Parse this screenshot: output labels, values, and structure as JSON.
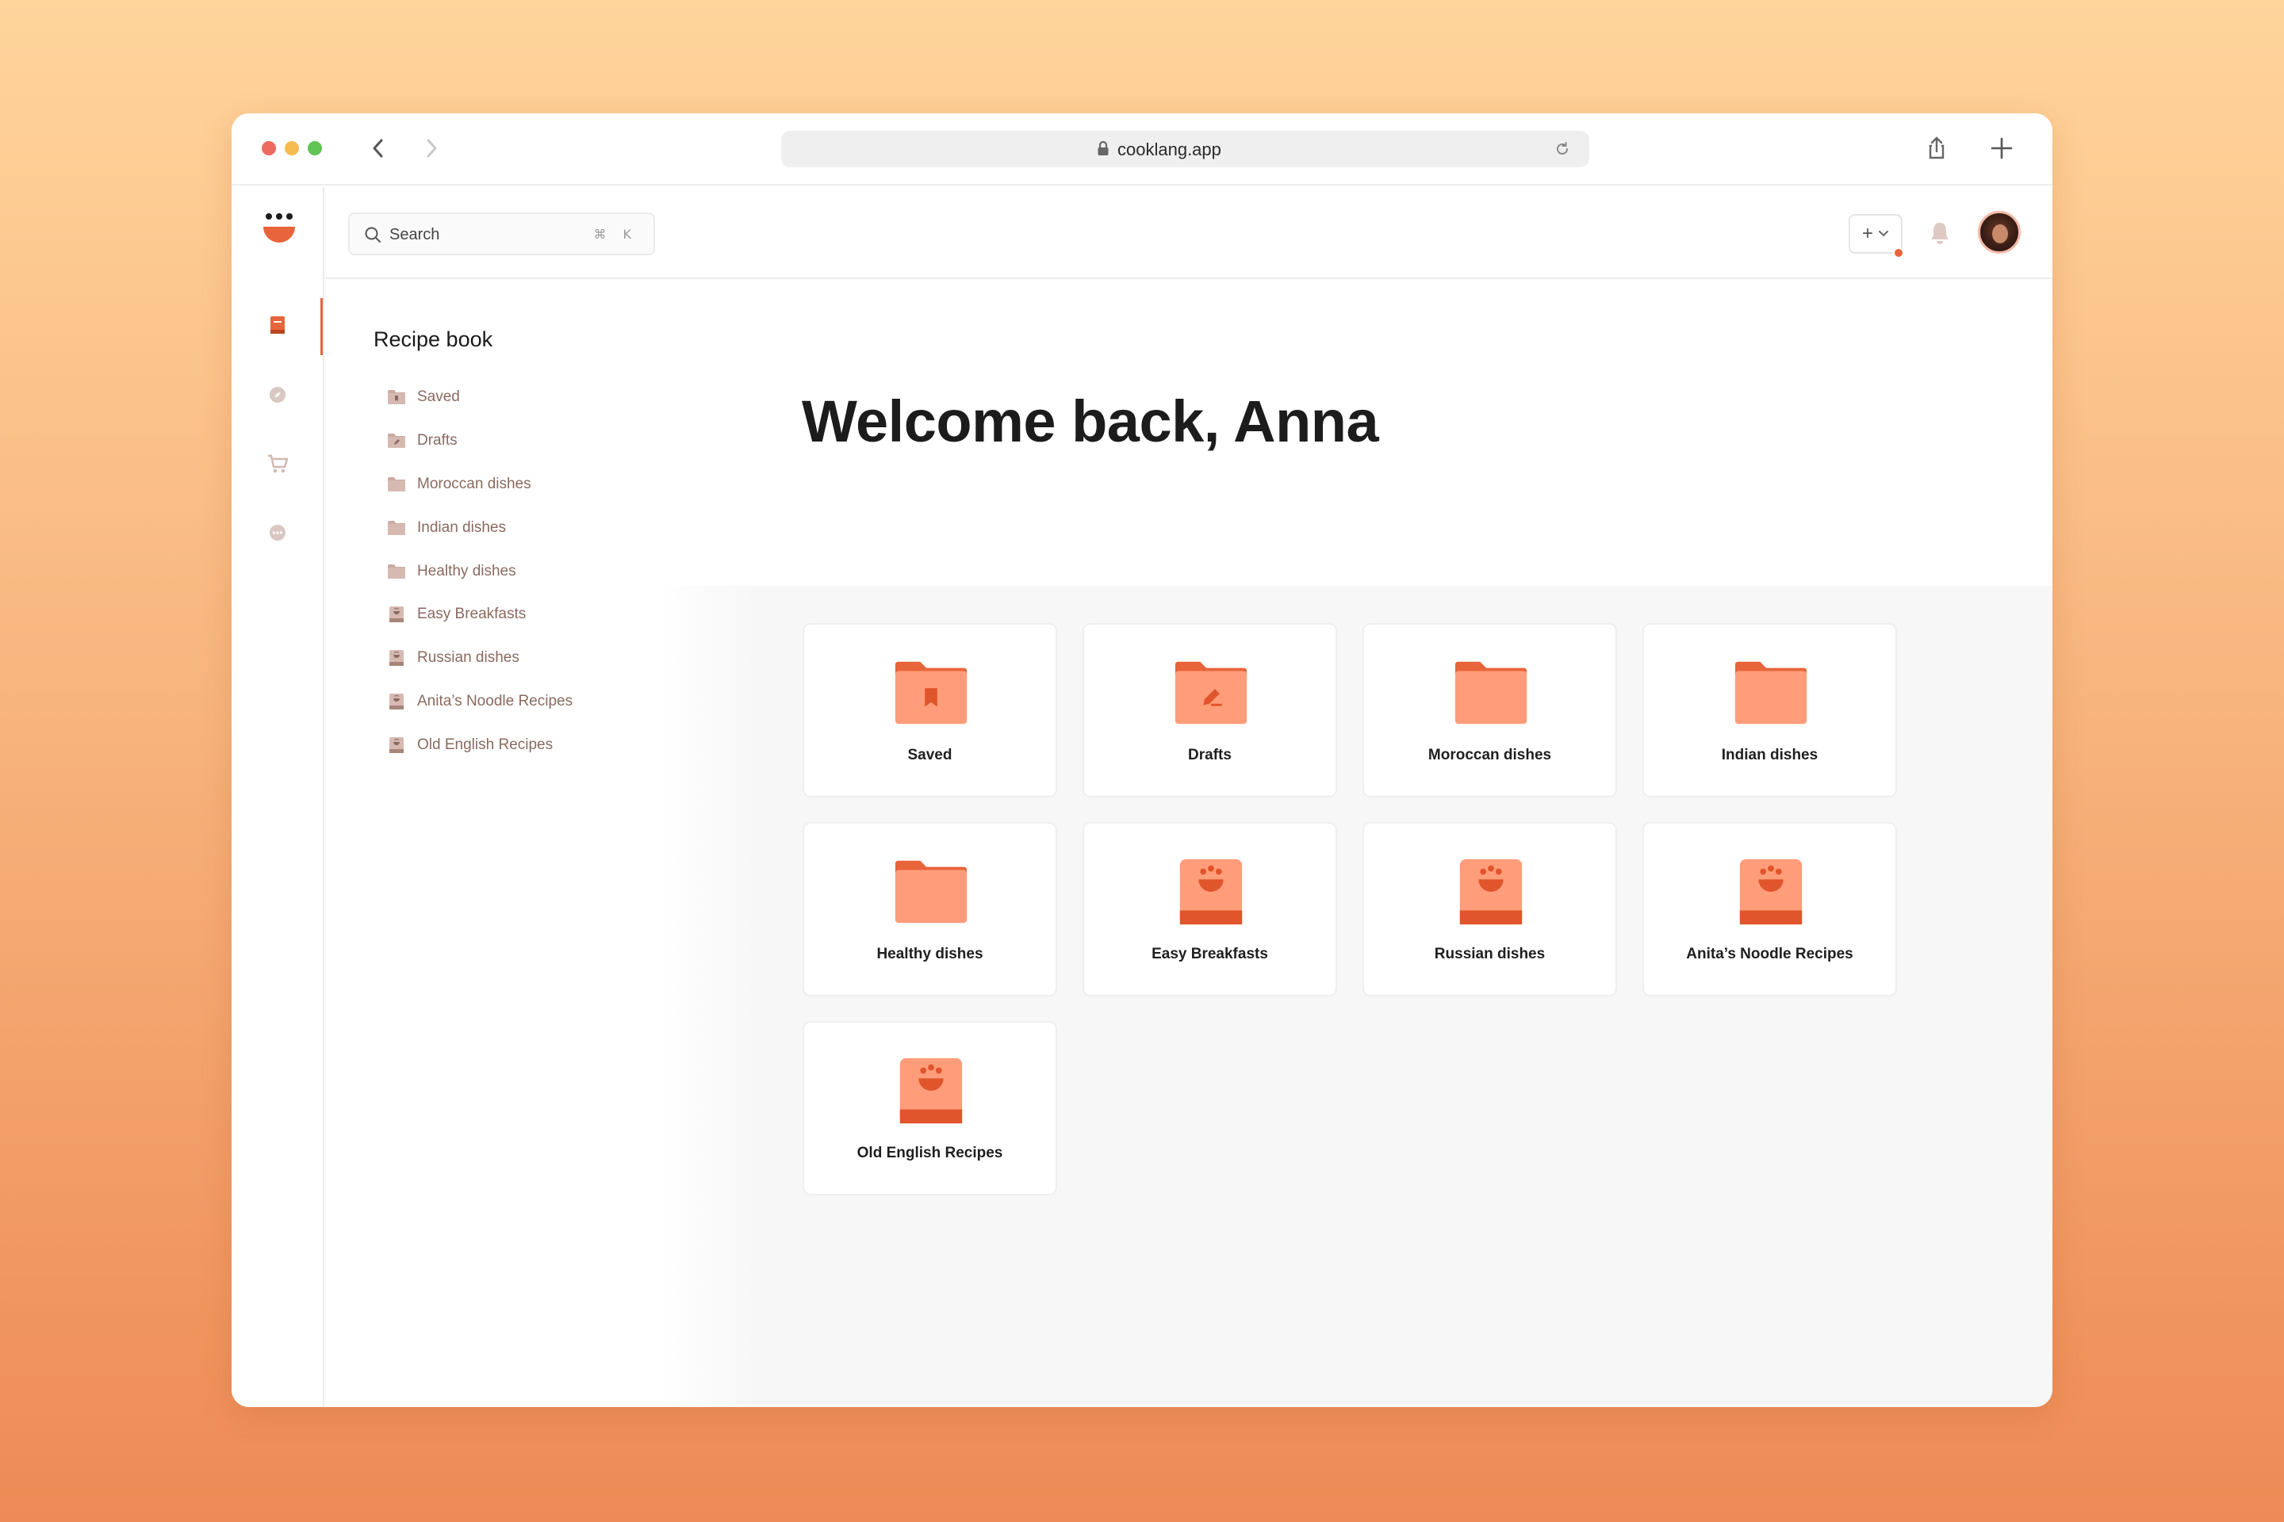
{
  "browser": {
    "url": "cooklang.app",
    "traffic_colors": [
      "#ee6a5f",
      "#f5bd4f",
      "#61c454"
    ]
  },
  "search": {
    "placeholder": "Search",
    "shortcut": "⌘ K"
  },
  "header": {
    "add_label": "+"
  },
  "colors": {
    "accent": "#e8643a",
    "folder": "#ff9d7a",
    "folder_tab": "#e8643a"
  },
  "sidebar": {
    "title": "Recipe book",
    "items": [
      {
        "label": "Saved",
        "icon": "folder-saved-icon"
      },
      {
        "label": "Drafts",
        "icon": "folder-drafts-icon"
      },
      {
        "label": "Moroccan dishes",
        "icon": "folder-icon"
      },
      {
        "label": "Indian dishes",
        "icon": "folder-icon"
      },
      {
        "label": "Healthy dishes",
        "icon": "folder-icon"
      },
      {
        "label": "Easy Breakfasts",
        "icon": "recipe-book-icon"
      },
      {
        "label": "Russian dishes",
        "icon": "recipe-book-icon"
      },
      {
        "label": "Anita’s Noodle Recipes",
        "icon": "recipe-book-icon"
      },
      {
        "label": "Old English Recipes",
        "icon": "recipe-book-icon"
      }
    ]
  },
  "main": {
    "welcome": "Welcome back, Anna",
    "cards": [
      {
        "label": "Saved",
        "icon": "folder-saved-icon"
      },
      {
        "label": "Drafts",
        "icon": "folder-drafts-icon"
      },
      {
        "label": "Moroccan dishes",
        "icon": "folder-icon"
      },
      {
        "label": "Indian dishes",
        "icon": "folder-icon"
      },
      {
        "label": "Healthy dishes",
        "icon": "folder-icon"
      },
      {
        "label": "Easy Breakfasts",
        "icon": "recipe-book-icon"
      },
      {
        "label": "Russian dishes",
        "icon": "recipe-book-icon"
      },
      {
        "label": "Anita’s Noodle Recipes",
        "icon": "recipe-book-icon"
      },
      {
        "label": "Old English Recipes",
        "icon": "recipe-book-icon"
      }
    ]
  }
}
